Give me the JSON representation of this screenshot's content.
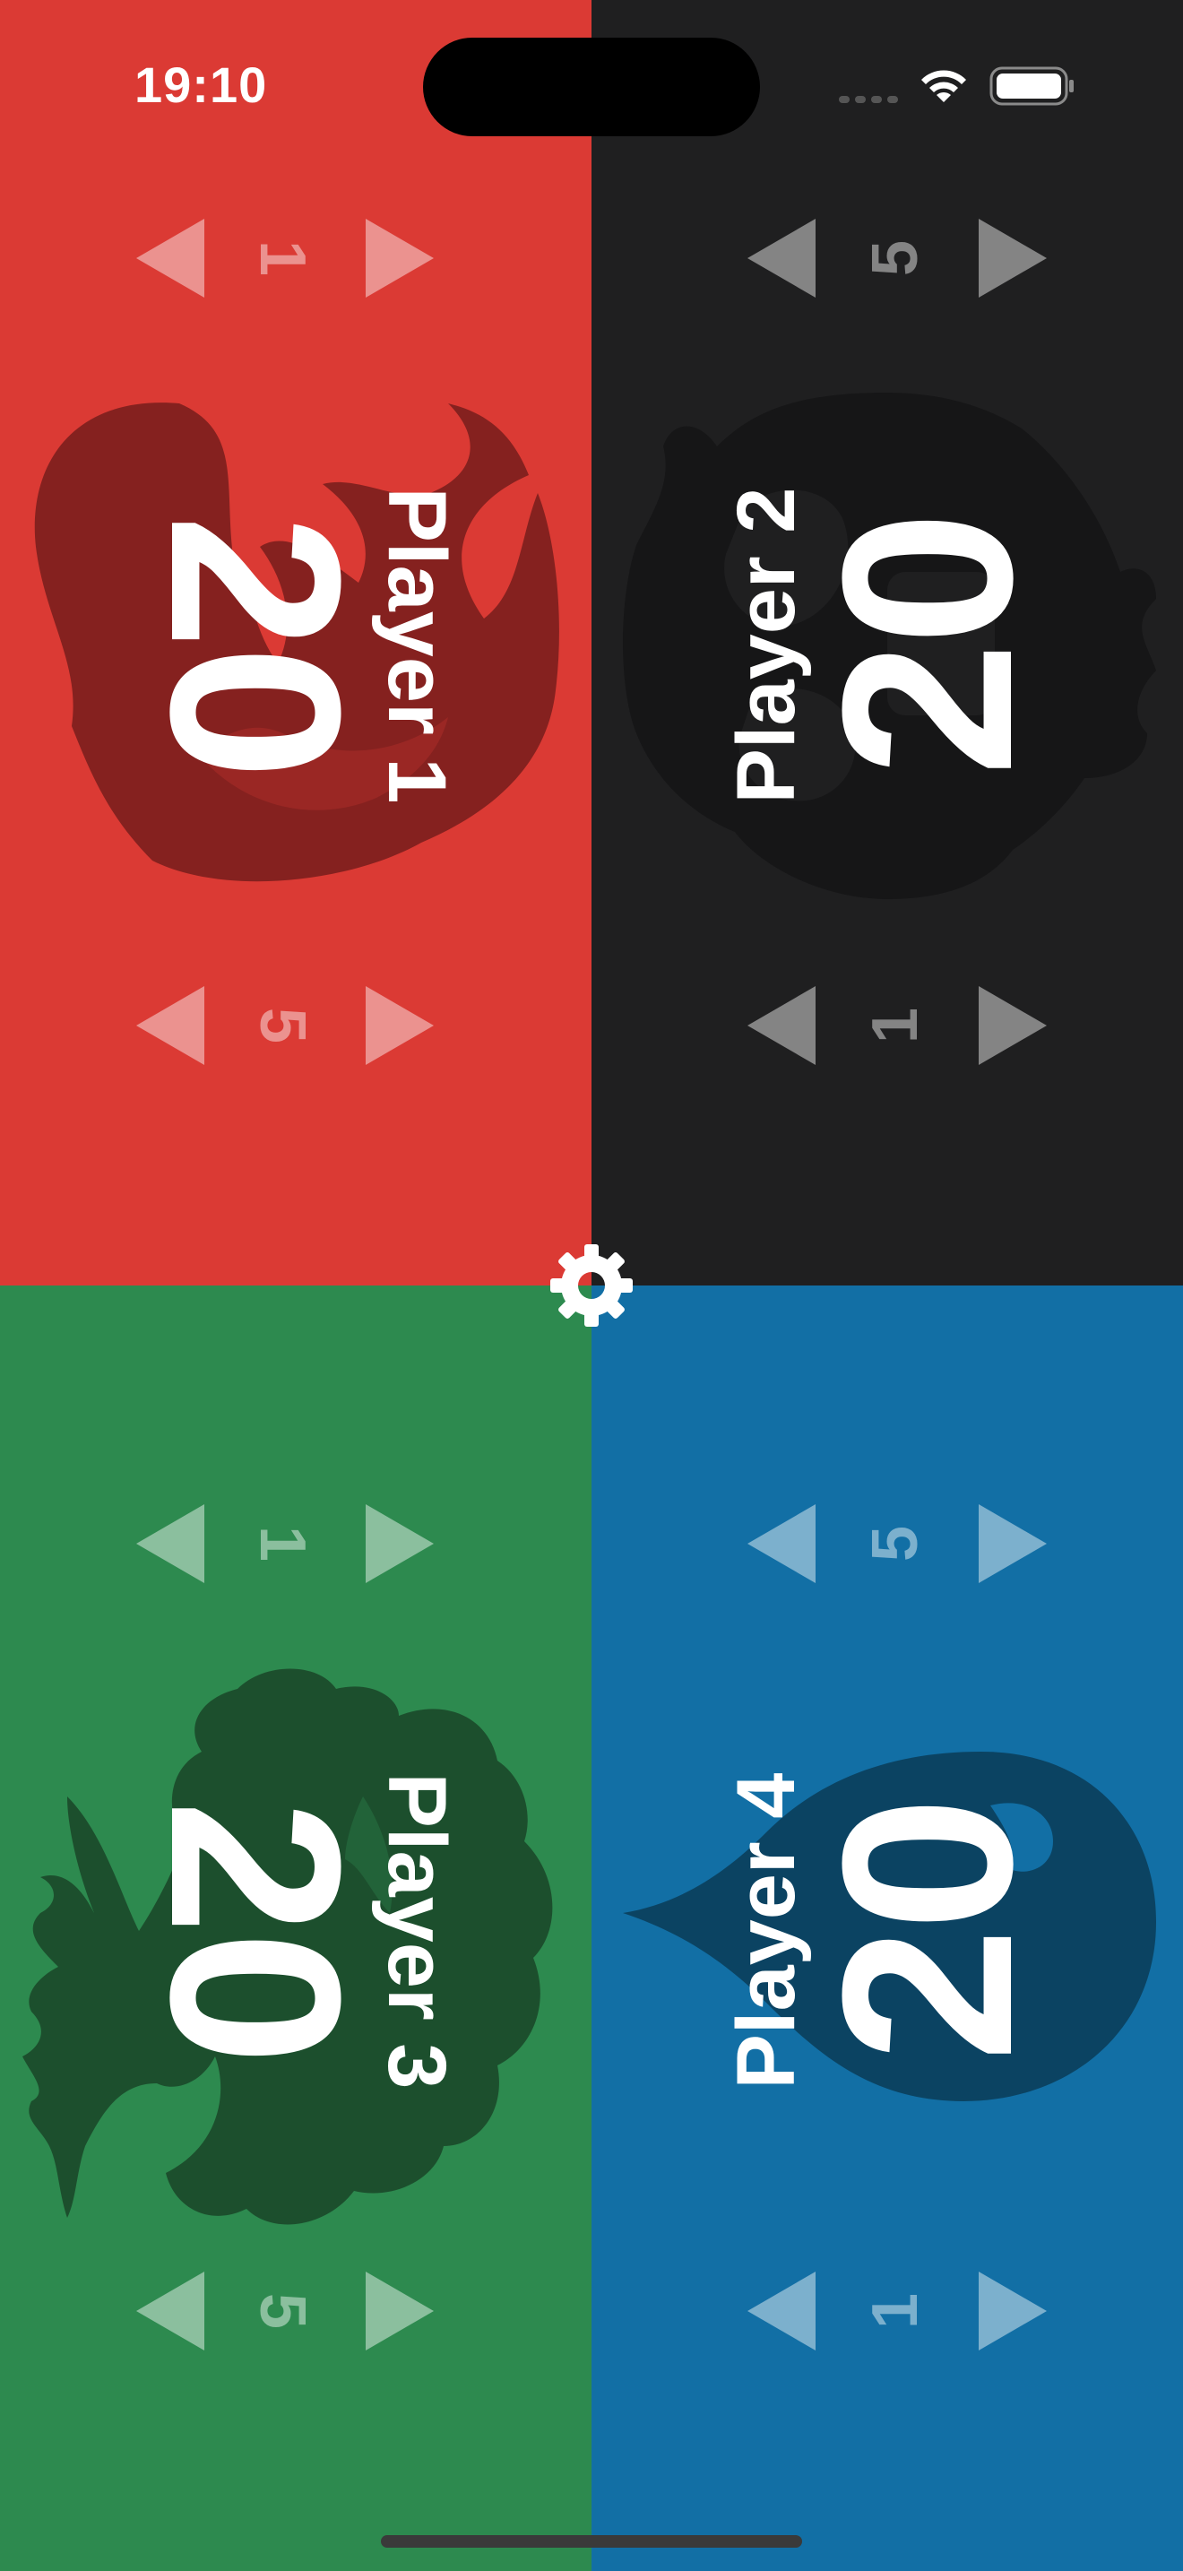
{
  "status_bar": {
    "time": "19:10"
  },
  "players": [
    {
      "name": "Player 1",
      "life": "20",
      "step_small": "1",
      "step_large": "5",
      "color": "#db3a34",
      "emblem": "fire-icon"
    },
    {
      "name": "Player 2",
      "life": "20",
      "step_small": "1",
      "step_large": "5",
      "color": "#1f1f20",
      "emblem": "skull-icon"
    },
    {
      "name": "Player 3",
      "life": "20",
      "step_small": "1",
      "step_large": "5",
      "color": "#2d8a4f",
      "emblem": "tree-icon"
    },
    {
      "name": "Player 4",
      "life": "20",
      "step_small": "1",
      "step_large": "5",
      "color": "#126fa5",
      "emblem": "water-drop-icon"
    }
  ],
  "settings": {
    "icon": "gear-icon"
  }
}
